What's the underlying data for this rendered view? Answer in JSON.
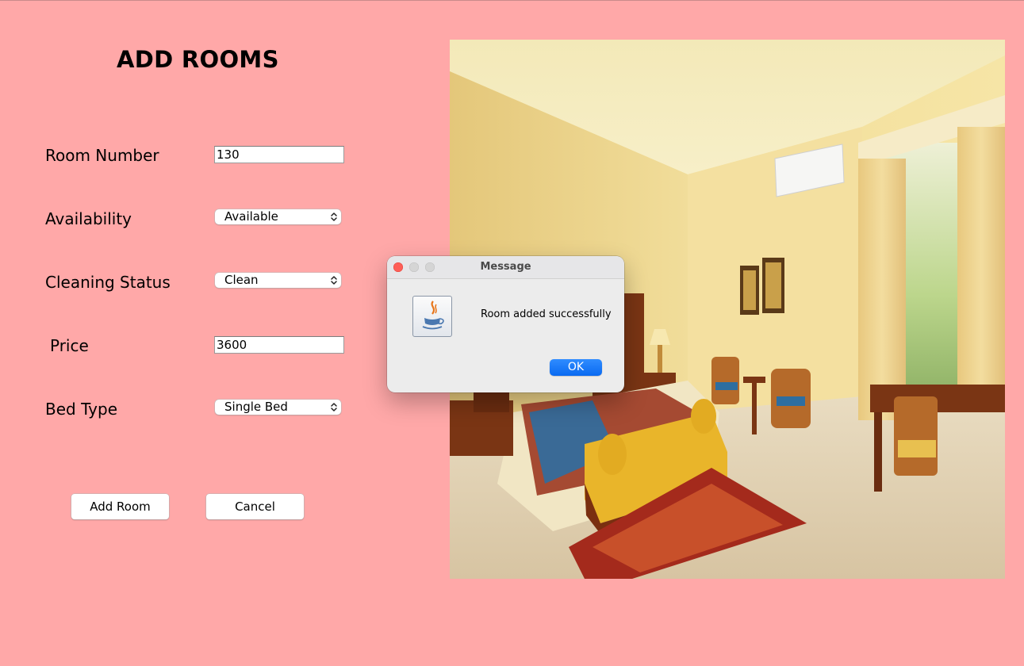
{
  "form": {
    "title": "ADD ROOMS",
    "room_number": {
      "label": "Room Number",
      "value": "130"
    },
    "availability": {
      "label": "Availability",
      "value": "Available"
    },
    "cleaning_status": {
      "label": "Cleaning Status",
      "value": "Clean"
    },
    "price": {
      "label": "Price",
      "value": "3600"
    },
    "bed_type": {
      "label": "Bed Type",
      "value": "Single Bed"
    },
    "add_button": "Add Room",
    "cancel_button": "Cancel"
  },
  "dialog": {
    "title": "Message",
    "message": "Room added successfully",
    "ok_button": "OK",
    "icon": "java-cup-icon"
  },
  "image": {
    "subject": "hotel bedroom"
  },
  "colors": {
    "background": "#ffa8a8",
    "ok_button": "#0a6af1"
  }
}
